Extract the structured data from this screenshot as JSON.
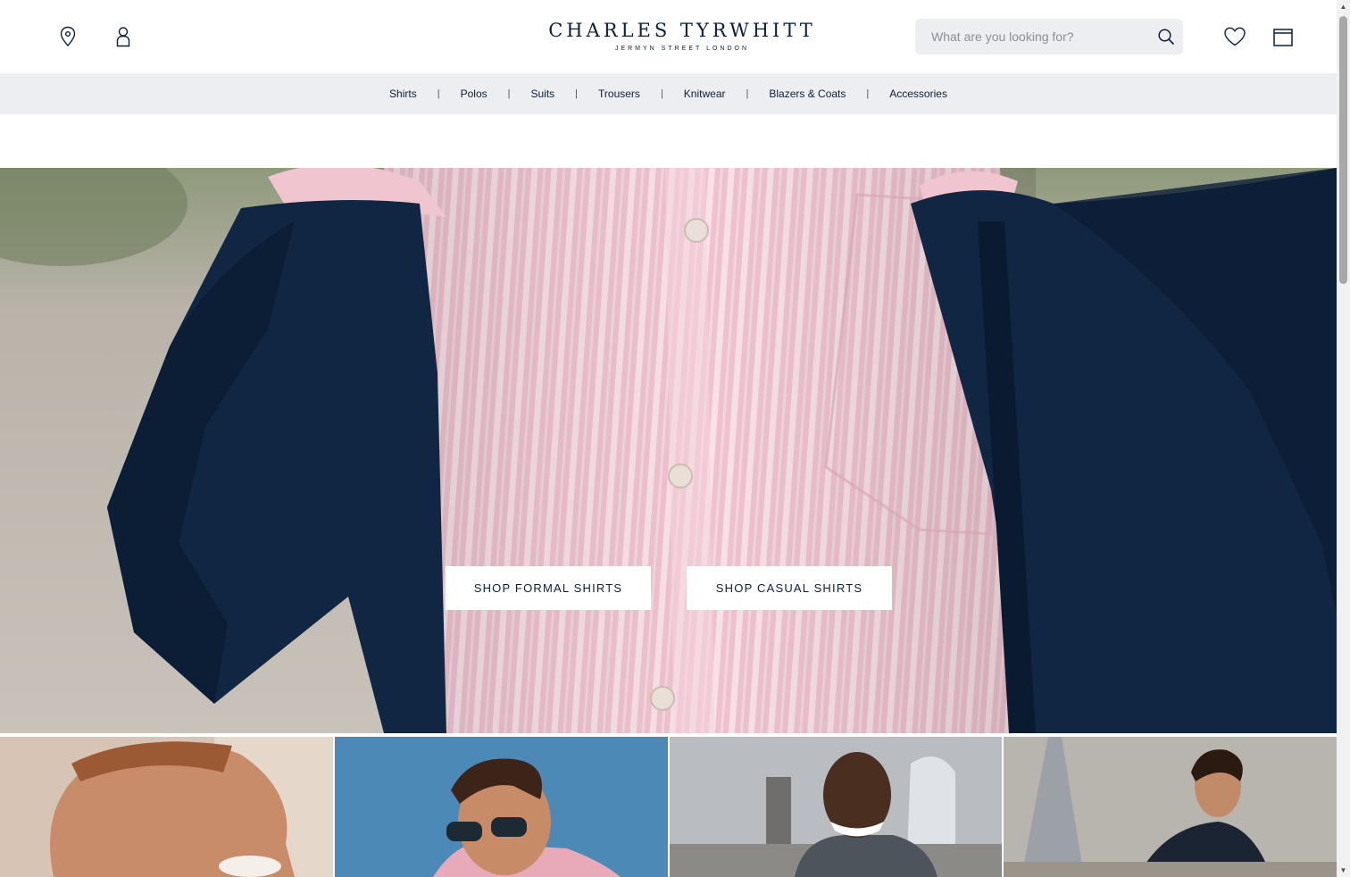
{
  "header": {
    "logo_main": "CHARLES TYRWHITT",
    "logo_sub": "JERMYN STREET LONDON",
    "search_placeholder": "What are you looking for?",
    "icons": [
      "location-pin-icon",
      "account-icon",
      "search-icon",
      "heart-icon",
      "bag-icon"
    ]
  },
  "nav": {
    "items": [
      {
        "label": "Shirts"
      },
      {
        "label": "Polos"
      },
      {
        "label": "Suits"
      },
      {
        "label": "Trousers"
      },
      {
        "label": "Knitwear"
      },
      {
        "label": "Blazers & Coats"
      },
      {
        "label": "Accessories"
      }
    ],
    "separator": "|"
  },
  "hero": {
    "buttons": [
      {
        "label": "SHOP FORMAL SHIRTS"
      },
      {
        "label": "SHOP CASUAL SHIRTS"
      }
    ]
  },
  "colors": {
    "brand_navy": "#0b1f3b",
    "nav_bg": "#eceef1",
    "shirt_pink": "#e9bcc8",
    "cardigan_navy": "#102642"
  }
}
